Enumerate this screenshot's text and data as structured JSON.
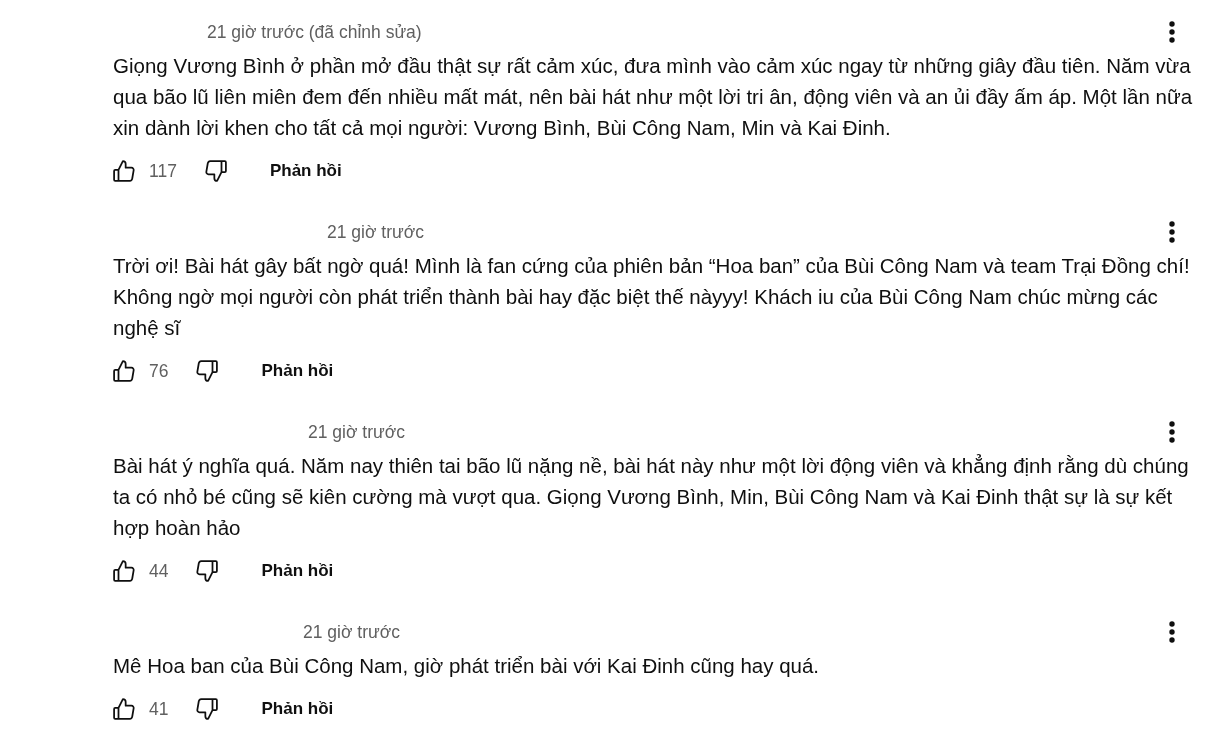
{
  "comments": [
    {
      "timestamp": "21 giờ trước (đã chỉnh sửa)",
      "text": "Giọng Vương Bình ở phần mở đầu thật sự rất cảm xúc, đưa mình vào cảm xúc ngay từ những giây đầu tiên. Năm vừa qua bão lũ liên miên đem đến nhiều mất mát, nên bài hát như một lời tri ân, động viên và an ủi đầy ấm áp. Một lần nữa xin dành lời khen cho tất cả mọi người: Vương Bình, Bùi Công Nam, Min và Kai Đinh.",
      "like_count": "117",
      "reply_label": "Phản hồi"
    },
    {
      "timestamp": "21 giờ trước",
      "text": "Trời ơi! Bài hát gây bất ngờ quá! Mình là fan cứng của phiên bản “Hoa ban” của Bùi Công Nam và team Trại Đồng chí! Không ngờ mọi người còn phát triển thành bài hay đặc biệt thế nàyyy! Khách iu của Bùi Công Nam chúc mừng các nghệ sĩ",
      "like_count": "76",
      "reply_label": "Phản hồi"
    },
    {
      "timestamp": "21 giờ trước",
      "text": "Bài hát ý nghĩa quá. Năm nay thiên tai bão lũ nặng nề, bài hát này như một lời động viên và khẳng định rằng dù chúng ta có nhỏ bé cũng sẽ kiên cường mà vượt qua. Giọng Vương Bình, Min, Bùi Công Nam và Kai Đinh thật sự là sự kết hợp hoàn hảo",
      "like_count": "44",
      "reply_label": "Phản hồi"
    },
    {
      "timestamp": "21 giờ trước",
      "text": "Mê Hoa ban của Bùi Công Nam, giờ phát triển bài với Kai Đinh cũng hay quá.",
      "like_count": "41",
      "reply_label": "Phản hồi"
    }
  ]
}
